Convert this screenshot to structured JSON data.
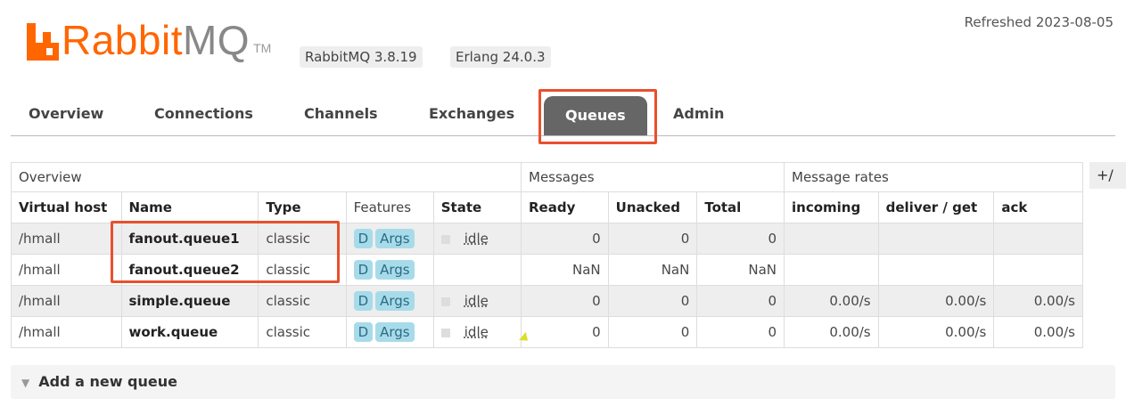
{
  "header": {
    "logo_rabbit": "Rabbit",
    "logo_mq": "MQ",
    "logo_tm": "TM",
    "version_label": "RabbitMQ 3.8.19",
    "erlang_label": "Erlang 24.0.3",
    "refreshed": "Refreshed 2023-08-05"
  },
  "tabs": [
    "Overview",
    "Connections",
    "Channels",
    "Exchanges",
    "Queues",
    "Admin"
  ],
  "active_tab": "Queues",
  "table": {
    "groups": {
      "overview": "Overview",
      "messages": "Messages",
      "rates": "Message rates",
      "toggle": "+/"
    },
    "columns": {
      "vhost": "Virtual host",
      "name": "Name",
      "type": "Type",
      "features": "Features",
      "state": "State",
      "ready": "Ready",
      "unacked": "Unacked",
      "total": "Total",
      "incoming": "incoming",
      "deliver": "deliver / get",
      "ack": "ack"
    },
    "rows": [
      {
        "vhost": "/hmall",
        "name": "fanout.queue1",
        "type": "classic",
        "f1": "D",
        "f2": "Args",
        "state": "idle",
        "ready": "0",
        "unacked": "0",
        "total": "0",
        "incoming": "",
        "deliver": "",
        "ack": ""
      },
      {
        "vhost": "/hmall",
        "name": "fanout.queue2",
        "type": "classic",
        "f1": "D",
        "f2": "Args",
        "state": "",
        "ready": "NaN",
        "unacked": "NaN",
        "total": "NaN",
        "incoming": "",
        "deliver": "",
        "ack": ""
      },
      {
        "vhost": "/hmall",
        "name": "simple.queue",
        "type": "classic",
        "f1": "D",
        "f2": "Args",
        "state": "idle",
        "ready": "0",
        "unacked": "0",
        "total": "0",
        "incoming": "0.00/s",
        "deliver": "0.00/s",
        "ack": "0.00/s"
      },
      {
        "vhost": "/hmall",
        "name": "work.queue",
        "type": "classic",
        "f1": "D",
        "f2": "Args",
        "state": "idle",
        "ready": "0",
        "unacked": "0",
        "total": "0",
        "incoming": "0.00/s",
        "deliver": "0.00/s",
        "ack": "0.00/s"
      }
    ]
  },
  "add_queue": "Add a new queue",
  "colors": {
    "brand": "#ff6600",
    "highlight": "#e8502d",
    "active_tab": "#666666",
    "badge": "#a8dbea"
  }
}
